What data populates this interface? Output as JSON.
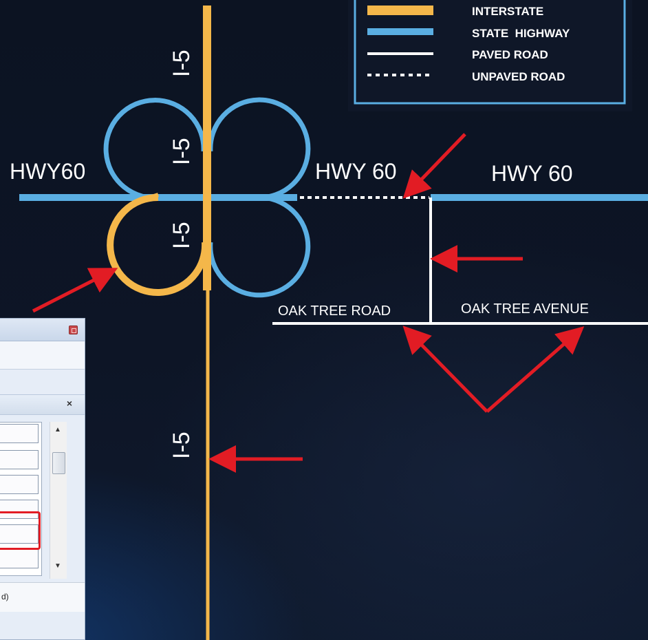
{
  "legend": {
    "items": [
      {
        "label": "INTERSTATE",
        "color": "#f4b74a",
        "style": "solid-thick"
      },
      {
        "label": "STATE  HIGHWAY",
        "color": "#5aaee2",
        "style": "solid-thick"
      },
      {
        "label": "PAVED ROAD",
        "color": "#ffffff",
        "style": "solid"
      },
      {
        "label": "UNPAVED ROAD",
        "color": "#ffffff",
        "style": "dotted"
      }
    ]
  },
  "labels": {
    "i5_top": "I-5",
    "i5_mid": "I-5",
    "i5_low": "I-5",
    "i5_south": "I-5",
    "hwy60_west": "HWY60",
    "hwy60_center": "HWY 60",
    "hwy60_east": "HWY 60",
    "oak_tree_road": "OAK TREE ROAD",
    "oak_tree_avenue": "OAK TREE AVENUE"
  },
  "dialog": {
    "panel_close_glyph": "×",
    "scroll_up_glyph": "▲",
    "scroll_down_glyph": "▼",
    "footer_text": "d)"
  },
  "colors": {
    "interstate": "#f4b74a",
    "state_highway": "#5aaee2",
    "road": "#ffffff",
    "annotation_arrow": "#e21c24",
    "background": "#0b1220"
  }
}
